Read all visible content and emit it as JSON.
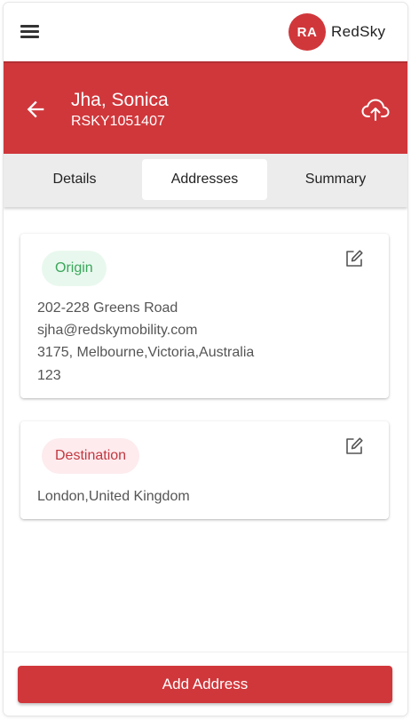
{
  "colors": {
    "brand_red": "#d0373b",
    "origin_pill_bg": "#e9f8ee",
    "origin_pill_text": "#3aa65a",
    "destination_pill_bg": "#fdebee",
    "destination_pill_text": "#c2373f"
  },
  "topbar": {
    "menu_icon": "hamburger-menu-icon",
    "avatar_initials": "RA",
    "brand_name": "RedSky"
  },
  "header": {
    "back_icon": "arrow-left-icon",
    "name": "Jha, Sonica",
    "reference": "RSKY1051407",
    "upload_icon": "cloud-upload-icon"
  },
  "tabs": [
    {
      "label": "Details",
      "active": false
    },
    {
      "label": "Addresses",
      "active": true
    },
    {
      "label": "Summary",
      "active": false
    }
  ],
  "addresses": [
    {
      "type_label": "Origin",
      "edit_icon": "edit-icon",
      "lines": [
        "202-228 Greens Road",
        "sjha@redskymobility.com",
        "3175, Melbourne,Victoria,Australia",
        "123"
      ]
    },
    {
      "type_label": "Destination",
      "edit_icon": "edit-icon",
      "lines": [
        "London,United Kingdom"
      ]
    }
  ],
  "footer": {
    "add_button_label": "Add Address"
  }
}
